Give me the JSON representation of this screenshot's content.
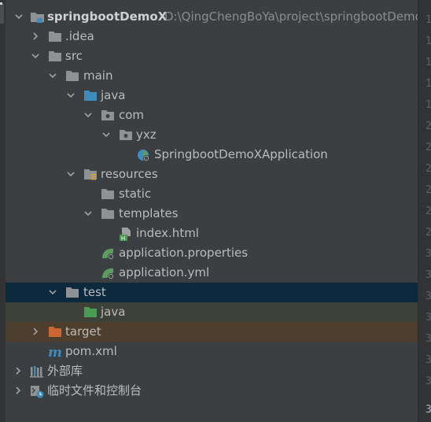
{
  "project_tree": {
    "root": {
      "label": "springbootDemoX",
      "path": "D:\\QingChengBoYa\\project\\springbootDemoX"
    },
    "nodes": {
      "idea": {
        "label": ".idea",
        "icon": "folder-icon"
      },
      "src": {
        "label": "src",
        "icon": "folder-icon"
      },
      "main": {
        "label": "main",
        "icon": "folder-icon"
      },
      "java": {
        "label": "java",
        "icon": "source-root-folder-icon"
      },
      "com": {
        "label": "com",
        "icon": "package-icon"
      },
      "yxz": {
        "label": "yxz",
        "icon": "package-icon"
      },
      "app_class": {
        "label": "SpringbootDemoXApplication",
        "icon": "spring-boot-class-icon"
      },
      "resources": {
        "label": "resources",
        "icon": "resources-root-folder-icon"
      },
      "static": {
        "label": "static",
        "icon": "folder-icon"
      },
      "templates": {
        "label": "templates",
        "icon": "folder-icon"
      },
      "index_html": {
        "label": "index.html",
        "icon": "html-file-icon"
      },
      "app_props": {
        "label": "application.properties",
        "icon": "spring-config-icon"
      },
      "app_yml": {
        "label": "application.yml",
        "icon": "spring-config-icon"
      },
      "test": {
        "label": "test",
        "icon": "folder-icon"
      },
      "test_java": {
        "label": "java",
        "icon": "test-root-folder-icon"
      },
      "target": {
        "label": "target",
        "icon": "excluded-folder-icon"
      },
      "pom": {
        "label": "pom.xml",
        "icon": "maven-icon"
      },
      "ext_libs": {
        "label": "外部库",
        "icon": "libraries-icon"
      },
      "scratches": {
        "label": "临时文件和控制台",
        "icon": "scratches-icon"
      }
    }
  },
  "colors": {
    "background": "#3c3f41",
    "selection": "#0d293e",
    "test_root_highlight": "#3d4137",
    "excluded_highlight": "#4e3e2e",
    "folder": "#8e9294",
    "source_folder": "#3c8dbc",
    "test_folder": "#499c54",
    "excluded_folder": "#cc6633"
  }
}
